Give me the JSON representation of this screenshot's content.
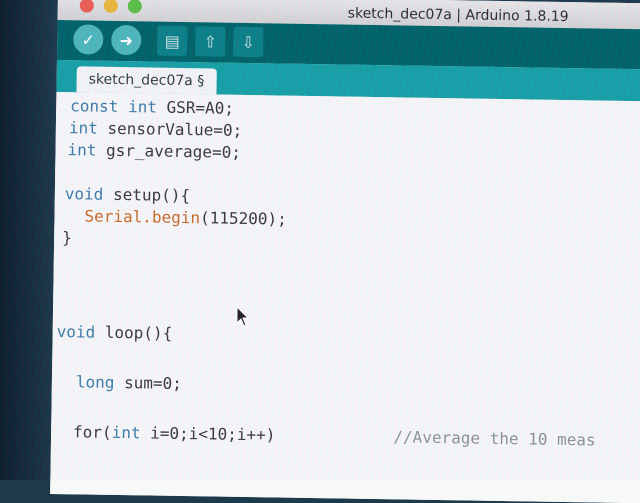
{
  "window": {
    "title": "sketch_dec07a | Arduino 1.8.19"
  },
  "toolbar": {
    "buttons": [
      {
        "name": "verify",
        "icon": "checkmark-icon",
        "glyph": "✓"
      },
      {
        "name": "upload",
        "icon": "arrow-right-icon",
        "glyph": "➜"
      },
      {
        "name": "new",
        "icon": "new-file-icon",
        "glyph": "▤"
      },
      {
        "name": "open",
        "icon": "arrow-up-icon",
        "glyph": "⇧"
      },
      {
        "name": "save",
        "icon": "arrow-down-icon",
        "glyph": "⇩"
      }
    ]
  },
  "tab": {
    "label": "sketch_dec07a §"
  },
  "code": {
    "line1": {
      "a": "const int ",
      "b": "GSR=A0;"
    },
    "line2": {
      "a": "int ",
      "b": "sensorValue=0;"
    },
    "line3": {
      "a": "int ",
      "b": "gsr_average=0;"
    },
    "line4": {
      "a": "void ",
      "b": "setup(){"
    },
    "line5": {
      "a": "Serial.begin",
      "b": "(115200);"
    },
    "line6": {
      "a": "}"
    },
    "line7": {
      "a": "void ",
      "b": "loop(){"
    },
    "line8": {
      "a": "long ",
      "b": "sum=0;"
    },
    "line9": {
      "a": "for(",
      "b": "int ",
      "c": "i=0;i<10;i++)",
      "d": "//Average the 10 meas"
    }
  },
  "colors": {
    "toolbar": "#006468",
    "tabstrip": "#17a1a5",
    "keyword": "#3d7da6",
    "function": "#c96a26"
  }
}
